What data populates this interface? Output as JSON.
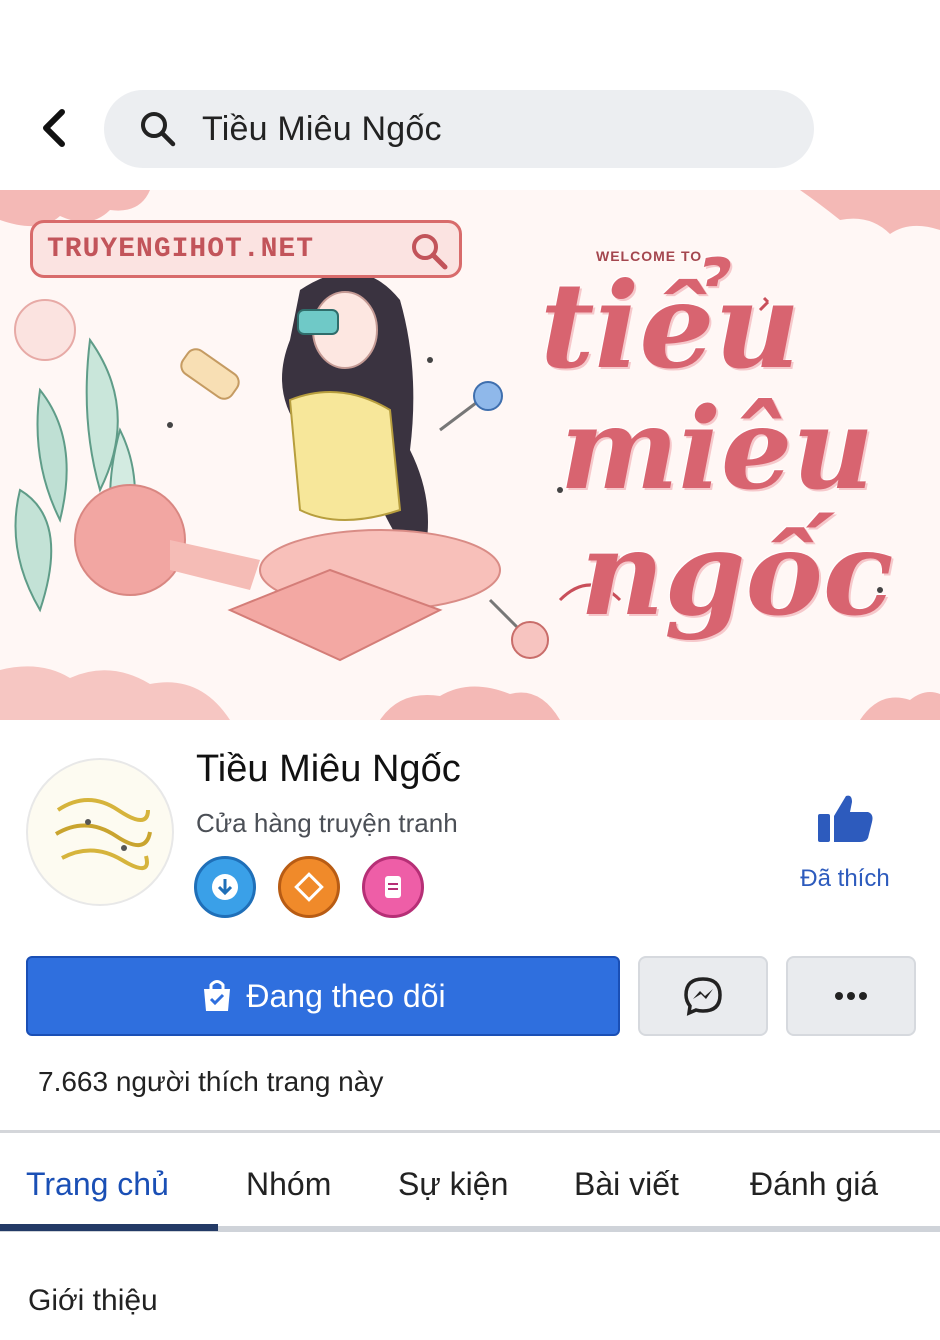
{
  "search": {
    "value": "Tiều Miêu Ngốc"
  },
  "cover": {
    "brand_text": "TRUYENGIHOT.NET",
    "welcome_text": "WELCOME TO",
    "script_lines": [
      "tiểu",
      "miêu",
      "ngốc"
    ]
  },
  "profile": {
    "name": "Tiều Miêu Ngốc",
    "category": "Cửa hàng truyện tranh",
    "liked_label": "Đã thích",
    "likes_count": "7.663 người thích trang này"
  },
  "actions": {
    "follow_label": "Đang theo dõi"
  },
  "tabs": [
    {
      "label": "Trang chủ",
      "active": true
    },
    {
      "label": "Nhóm",
      "active": false
    },
    {
      "label": "Sự kiện",
      "active": false
    },
    {
      "label": "Bài viết",
      "active": false
    },
    {
      "label": "Đánh giá",
      "active": false
    }
  ],
  "section": {
    "title": "Giới thiệu"
  },
  "colors": {
    "accent": "#2f6fde",
    "cover_pink": "#d86470",
    "link_blue": "#2d5bbd"
  },
  "icons": [
    "back-arrow-icon",
    "search-icon",
    "like-thumb-icon",
    "bag-icon",
    "messenger-icon",
    "more-icon"
  ]
}
